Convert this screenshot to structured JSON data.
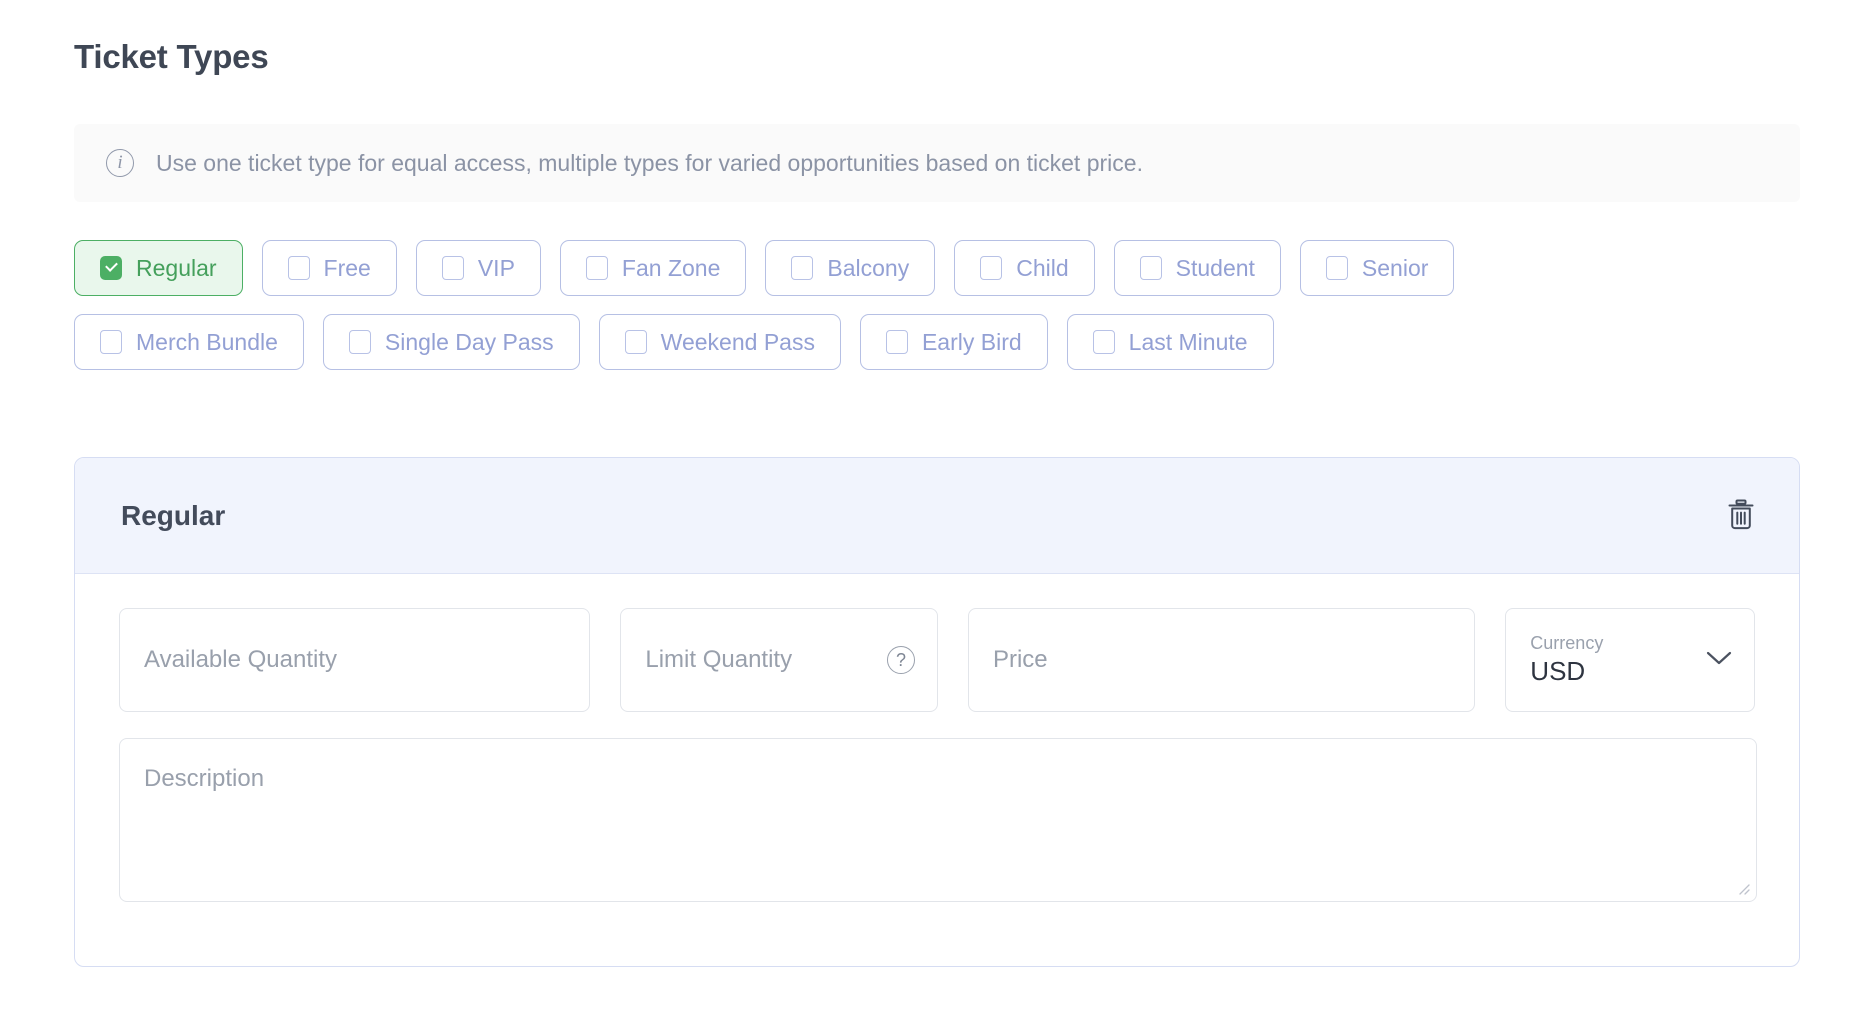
{
  "page": {
    "title": "Ticket Types"
  },
  "info_banner": {
    "icon": "info-circle-icon",
    "text": "Use one ticket type for equal access, multiple types for varied opportunities based on ticket price."
  },
  "ticket_type_chips": {
    "rows": [
      [
        {
          "label": "Regular",
          "selected": true
        },
        {
          "label": "Free",
          "selected": false
        },
        {
          "label": "VIP",
          "selected": false
        },
        {
          "label": "Fan Zone",
          "selected": false
        },
        {
          "label": "Balcony",
          "selected": false
        },
        {
          "label": "Child",
          "selected": false
        },
        {
          "label": "Student",
          "selected": false
        },
        {
          "label": "Senior",
          "selected": false
        }
      ],
      [
        {
          "label": "Merch Bundle",
          "selected": false
        },
        {
          "label": "Single Day Pass",
          "selected": false
        },
        {
          "label": "Weekend Pass",
          "selected": false
        },
        {
          "label": "Early Bird",
          "selected": false
        },
        {
          "label": "Last Minute",
          "selected": false
        }
      ]
    ]
  },
  "detail_panel": {
    "header": {
      "title": "Regular",
      "delete_icon": "trash-icon"
    },
    "fields": {
      "available_quantity": {
        "placeholder": "Available Quantity",
        "value": ""
      },
      "limit_quantity": {
        "placeholder": "Limit Quantity",
        "value": "",
        "help_icon": "question-circle-icon"
      },
      "price": {
        "placeholder": "Price",
        "value": ""
      },
      "currency": {
        "label": "Currency",
        "value": "USD",
        "chevron_icon": "chevron-down-icon"
      },
      "description": {
        "placeholder": "Description",
        "value": ""
      }
    }
  },
  "colors": {
    "title_text": "#3f4755",
    "banner_bg": "#fafafa",
    "banner_text": "#8b93a5",
    "chip_border": "#b6c0e4",
    "chip_text": "#93a0d4",
    "chip_selected_border": "#4caf64",
    "chip_selected_bg": "#e9f7ec",
    "chip_selected_text": "#45a05c",
    "panel_border": "#d6ddf3",
    "panel_header_bg": "#f1f4fd",
    "field_border": "#e2e5ea",
    "placeholder_text": "#99a0ac"
  }
}
